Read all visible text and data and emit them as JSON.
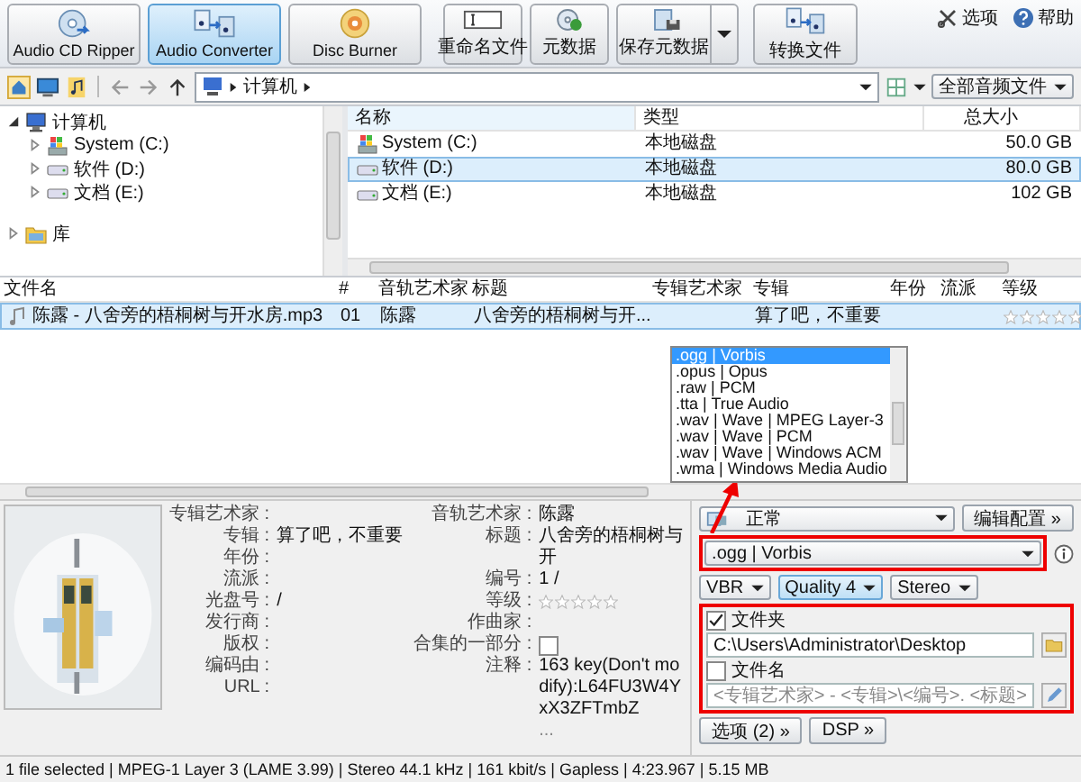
{
  "toolbar": {
    "modes": [
      {
        "label": "Audio CD Ripper",
        "kind": "cd",
        "selected": false
      },
      {
        "label": "Audio Converter",
        "kind": "convert",
        "selected": true
      },
      {
        "label": "Disc Burner",
        "kind": "disc",
        "selected": false
      }
    ],
    "actions": [
      {
        "label": "重命名文件",
        "kind": "rename"
      },
      {
        "label": "元数据",
        "kind": "metadata"
      },
      {
        "label": "保存元数据",
        "kind": "save"
      },
      {
        "label": "转换文件",
        "kind": "convert"
      }
    ],
    "links": [
      {
        "label": "选项",
        "kind": "options"
      },
      {
        "label": "帮助",
        "kind": "help"
      }
    ]
  },
  "navigation": {
    "path": "计算机",
    "filter": "全部音频文件"
  },
  "tree": [
    {
      "label": "计算机",
      "kind": "computer",
      "expanded": true,
      "children": [
        {
          "label": "System (C:)",
          "kind": "system",
          "expanded": false
        },
        {
          "label": "软件 (D:)",
          "kind": "drive",
          "expanded": false
        },
        {
          "label": "文档 (E:)",
          "kind": "drive",
          "expanded": false
        }
      ]
    },
    {
      "label": "库",
      "kind": "library",
      "expanded": false
    }
  ],
  "drives": {
    "columns": [
      "名称",
      "类型",
      "总大小"
    ],
    "rows": [
      {
        "name": "System (C:)",
        "kind": "system",
        "type": "本地磁盘",
        "size": "50.0 GB",
        "selected": false
      },
      {
        "name": "软件 (D:)",
        "kind": "drive",
        "type": "本地磁盘",
        "size": "80.0 GB",
        "selected": true
      },
      {
        "name": "文档 (E:)",
        "kind": "drive",
        "type": "本地磁盘",
        "size": "102 GB",
        "selected": false
      }
    ]
  },
  "tracks": {
    "columns": [
      "文件名",
      "#",
      "音轨艺术家",
      "标题",
      "专辑艺术家",
      "专辑",
      "年份",
      "流派",
      "等级"
    ],
    "rows": [
      {
        "file": "陈露 - 八舍旁的梧桐树与开水房.mp3",
        "number": "01",
        "track_artist": "陈露",
        "title": "八舍旁的梧桐树与开...",
        "album": "算了吧，不重要",
        "stars": 0,
        "selected": true
      }
    ]
  },
  "tags": {
    "left": [
      {
        "label": "专辑艺术家 :"
      },
      {
        "label": "专辑 :",
        "value": "算了吧，不重要"
      },
      {
        "label": "年份 :"
      },
      {
        "label": "流派 :"
      },
      {
        "label": "光盘号 :",
        "value": "/"
      },
      {
        "label": "发行商 :"
      },
      {
        "label": "版权 :"
      },
      {
        "label": "编码由 :"
      },
      {
        "label": "URL :"
      }
    ],
    "right": [
      {
        "label": "音轨艺术家 :",
        "kind": "text",
        "value": "陈露"
      },
      {
        "label": "标题 :",
        "kind": "text",
        "value": "八舍旁的梧桐树与开"
      },
      {
        "label": "编号 :",
        "kind": "text",
        "value": "1    /"
      },
      {
        "label": "等级 :",
        "kind": "stars",
        "stars": 0
      },
      {
        "label": "作曲家 :",
        "kind": "text"
      },
      {
        "label": "合集的一部分 :",
        "kind": "checkbox",
        "checked": false
      },
      {
        "label": "注释 :",
        "kind": "text",
        "value": "163 key(Don't modify):L64FU3W4YxX3ZFTmbZ"
      }
    ],
    "more": "..."
  },
  "format_list": [
    {
      "label": ".ogg | Vorbis",
      "selected": true
    },
    {
      "label": ".opus | Opus",
      "selected": false
    },
    {
      "label": ".raw | PCM",
      "selected": false
    },
    {
      "label": ".tta | True Audio",
      "selected": false
    },
    {
      "label": ".wav | Wave | MPEG Layer-3",
      "selected": false
    },
    {
      "label": ".wav | Wave | PCM",
      "selected": false
    },
    {
      "label": ".wav | Wave | Windows ACM",
      "selected": false
    },
    {
      "label": ".wma | Windows Media Audio",
      "selected": false
    }
  ],
  "converter": {
    "profile": "正常",
    "edit_button": "编辑配置 »",
    "format": ".ogg | Vorbis",
    "mode": "VBR",
    "quality": "Quality 4",
    "channels": "Stereo",
    "folder": {
      "label": "文件夹",
      "checked": true,
      "value": "C:\\Users\\Administrator\\Desktop"
    },
    "filename": {
      "label": "文件名",
      "checked": false,
      "value": "<专辑艺术家> - <专辑>\\<编号>. <标题>"
    },
    "buttons": [
      "选项 (2) »",
      "DSP »"
    ]
  },
  "status_bar": "1 file selected | MPEG-1 Layer 3 (LAME 3.99) | Stereo 44.1 kHz | 161 kbit/s | Gapless | 4:23.967 | 5.15 MB"
}
